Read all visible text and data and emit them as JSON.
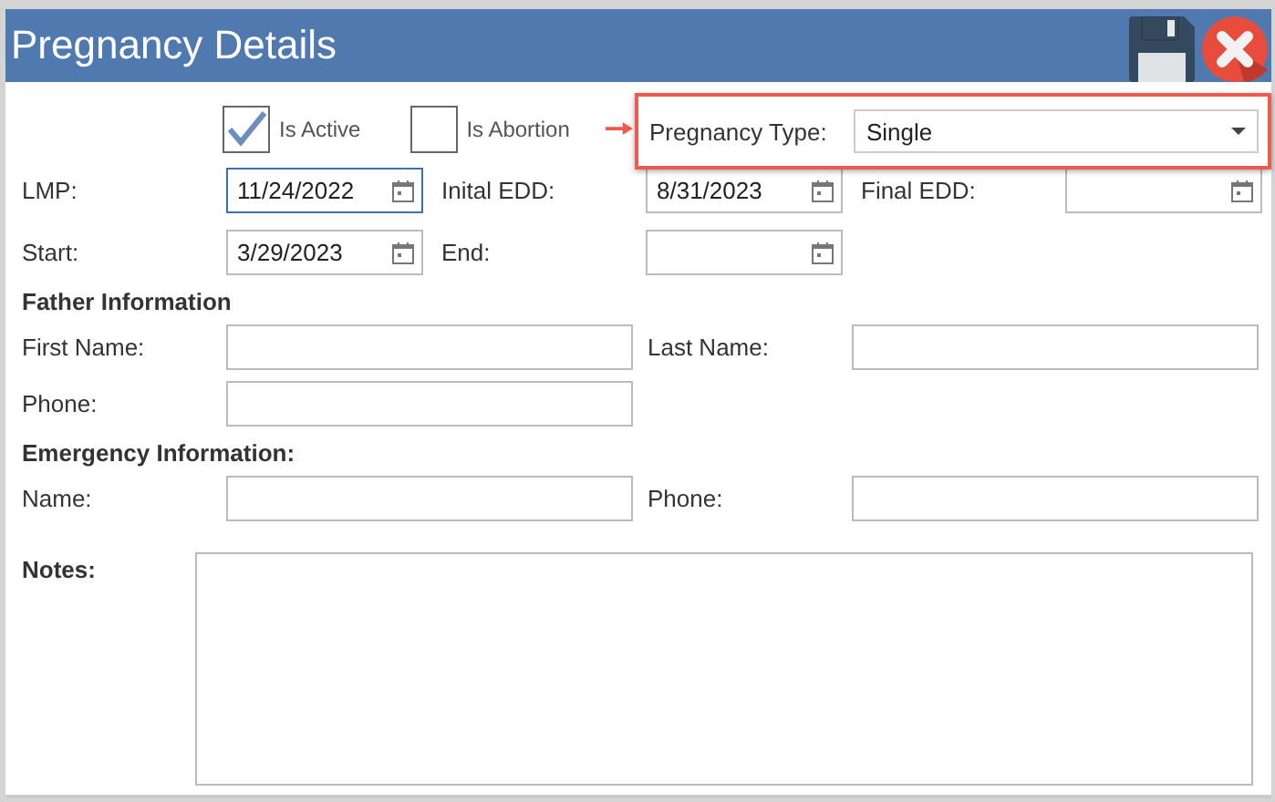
{
  "window": {
    "title": "Pregnancy Details"
  },
  "flags": [
    {
      "label": "Is Active",
      "checked": true
    },
    {
      "label": "Is Abortion",
      "checked": false
    }
  ],
  "pregnancy_type": {
    "label": "Pregnancy Type:",
    "value": "Single"
  },
  "dates": [
    [
      {
        "label": "LMP:",
        "value": "11/24/2022",
        "focused": true
      },
      {
        "label": "Inital EDD:",
        "value": "8/31/2023",
        "focused": false
      },
      {
        "label": "Final EDD:",
        "focused": false
      }
    ],
    [
      {
        "label": "Start:",
        "value": "3/29/2023",
        "focused": false
      },
      {
        "label": "End:",
        "focused": false
      }
    ]
  ],
  "father": {
    "heading": "Father Information",
    "fields": [
      {
        "label": "First Name:"
      },
      {
        "label": "Last Name:"
      },
      {
        "label": "Phone:"
      }
    ]
  },
  "emergency": {
    "heading": "Emergency Information:",
    "fields": [
      {
        "label": "Name:"
      },
      {
        "label": "Phone:"
      }
    ]
  },
  "notes": {
    "label": "Notes:"
  }
}
